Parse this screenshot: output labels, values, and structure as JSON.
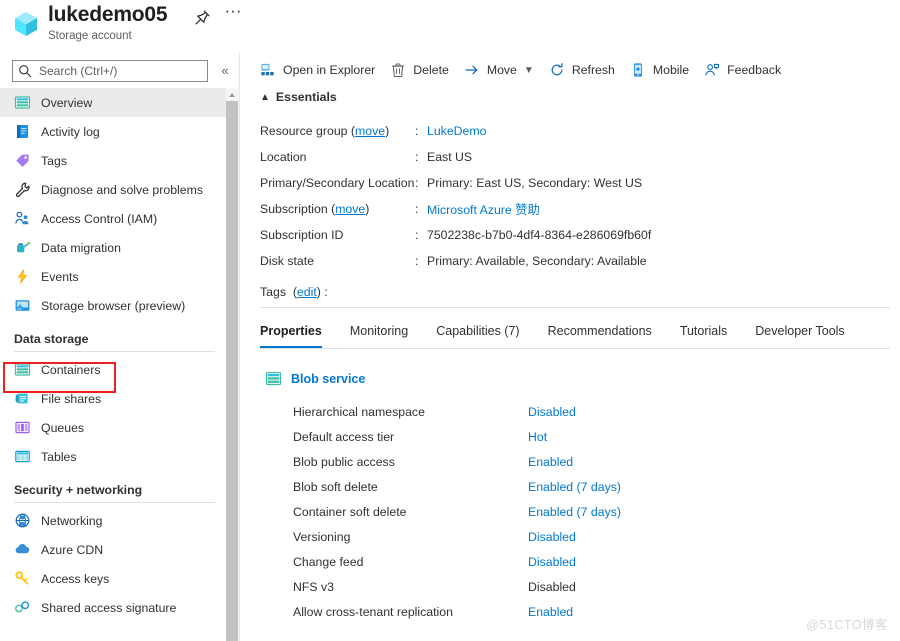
{
  "header": {
    "title": "lukedemo05",
    "subtitle": "Storage account",
    "pin_icon": "pin-icon",
    "more_icon": "ellipsis-icon",
    "resource_icon": "storage-account-cube-icon"
  },
  "search": {
    "placeholder": "Search (Ctrl+/)",
    "value": "",
    "icon": "search-icon",
    "collapse_icon": "chevron-double-left-icon"
  },
  "sidebar": {
    "items": [
      {
        "label": "Overview",
        "icon": "overview-icon",
        "selected": true
      },
      {
        "label": "Activity log",
        "icon": "activity-log-icon",
        "selected": false
      },
      {
        "label": "Tags",
        "icon": "tag-icon",
        "selected": false
      },
      {
        "label": "Diagnose and solve problems",
        "icon": "wrench-icon",
        "selected": false
      },
      {
        "label": "Access Control (IAM)",
        "icon": "users-icon",
        "selected": false
      },
      {
        "label": "Data migration",
        "icon": "watering-can-icon",
        "selected": false
      },
      {
        "label": "Events",
        "icon": "lightning-bolt-icon",
        "selected": false
      },
      {
        "label": "Storage browser (preview)",
        "icon": "storage-browser-icon",
        "selected": false
      }
    ],
    "groups": [
      {
        "title": "Data storage",
        "items": [
          {
            "label": "Containers",
            "icon": "containers-icon",
            "highlighted": true
          },
          {
            "label": "File shares",
            "icon": "file-share-icon",
            "highlighted": false
          },
          {
            "label": "Queues",
            "icon": "queues-icon",
            "highlighted": false
          },
          {
            "label": "Tables",
            "icon": "tables-icon",
            "highlighted": false
          }
        ]
      },
      {
        "title": "Security + networking",
        "items": [
          {
            "label": "Networking",
            "icon": "networking-icon",
            "highlighted": false
          },
          {
            "label": "Azure CDN",
            "icon": "cloud-icon",
            "highlighted": false
          },
          {
            "label": "Access keys",
            "icon": "key-icon",
            "highlighted": false
          },
          {
            "label": "Shared access signature",
            "icon": "sas-link-icon",
            "highlighted": false
          }
        ]
      }
    ]
  },
  "toolbar": {
    "items": [
      {
        "label": "Open in Explorer",
        "icon": "open-in-explorer-icon",
        "caret": false
      },
      {
        "label": "Delete",
        "icon": "trash-icon",
        "caret": false
      },
      {
        "label": "Move",
        "icon": "arrow-right-icon",
        "caret": true
      },
      {
        "label": "Refresh",
        "icon": "refresh-icon",
        "caret": false
      },
      {
        "label": "Mobile",
        "icon": "mobile-icon",
        "caret": false
      },
      {
        "label": "Feedback",
        "icon": "feedback-person-icon",
        "caret": false
      }
    ]
  },
  "essentials": {
    "label": "Essentials",
    "chevron_icon": "chevron-up-icon",
    "rows": [
      {
        "key": "Resource group",
        "key_link": "move",
        "value": "LukeDemo",
        "is_link": true
      },
      {
        "key": "Location",
        "key_link": "",
        "value": "East US",
        "is_link": false
      },
      {
        "key": "Primary/Secondary Location",
        "key_link": "",
        "value": "Primary: East US, Secondary: West US",
        "is_link": false
      },
      {
        "key": "Subscription",
        "key_link": "move",
        "value": "Microsoft Azure 赞助",
        "is_link": true
      },
      {
        "key": "Subscription ID",
        "key_link": "",
        "value": "7502238c-b7b0-4df4-8364-e286069fb60f",
        "is_link": false
      },
      {
        "key": "Disk state",
        "key_link": "",
        "value": "Primary: Available, Secondary: Available",
        "is_link": false
      }
    ],
    "tags_label": "Tags",
    "tags_link": "edit",
    "tags_value": ""
  },
  "tabs": [
    {
      "label": "Properties",
      "active": true
    },
    {
      "label": "Monitoring",
      "active": false
    },
    {
      "label": "Capabilities (7)",
      "active": false
    },
    {
      "label": "Recommendations",
      "active": false
    },
    {
      "label": "Tutorials",
      "active": false
    },
    {
      "label": "Developer Tools",
      "active": false
    }
  ],
  "blob_service": {
    "title": "Blob service",
    "icon": "blob-service-icon",
    "properties": [
      {
        "key": "Hierarchical namespace",
        "value": "Disabled",
        "is_link": true
      },
      {
        "key": "Default access tier",
        "value": "Hot",
        "is_link": true
      },
      {
        "key": "Blob public access",
        "value": "Enabled",
        "is_link": true
      },
      {
        "key": "Blob soft delete",
        "value": "Enabled (7 days)",
        "is_link": true
      },
      {
        "key": "Container soft delete",
        "value": "Enabled (7 days)",
        "is_link": true
      },
      {
        "key": "Versioning",
        "value": "Disabled",
        "is_link": true
      },
      {
        "key": "Change feed",
        "value": "Disabled",
        "is_link": true
      },
      {
        "key": "NFS v3",
        "value": "Disabled",
        "is_link": false
      },
      {
        "key": "Allow cross-tenant replication",
        "value": "Enabled",
        "is_link": true
      }
    ]
  },
  "watermark": "@51CTO博客",
  "colors": {
    "accent": "#0078d4",
    "selected_bg": "#edebe9",
    "highlight_box": "#ef2020",
    "text": "#323130"
  }
}
